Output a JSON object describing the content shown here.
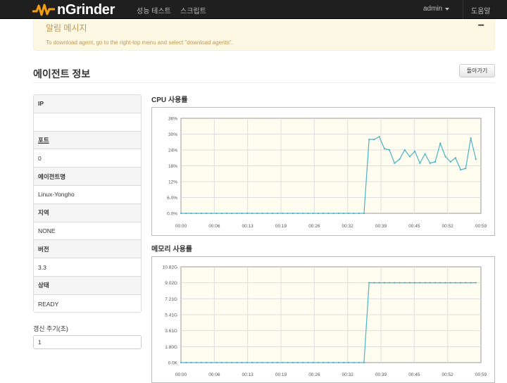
{
  "header": {
    "logo_text": "nGrinder",
    "nav": [
      "성능 테스트",
      "스크립트"
    ],
    "user": "admin",
    "help": "도움말"
  },
  "alert": {
    "title": "알림 메시지",
    "close": "−",
    "message": "To download agent, go to the right-top menu and select \"download agents\"."
  },
  "page": {
    "title": "에이전트 정보",
    "back_button": "돌아가기"
  },
  "agent_info": [
    {
      "label": "IP",
      "value": ""
    },
    {
      "label": "포트",
      "value": "0"
    },
    {
      "label": "에이전트명",
      "value": "Linux-Yongho"
    },
    {
      "label": "지역",
      "value": "NONE"
    },
    {
      "label": "버전",
      "value": "3.3"
    },
    {
      "label": "상태",
      "value": "READY"
    }
  ],
  "refresh": {
    "label": "갱신 주기(초)",
    "value": "1"
  },
  "colors": {
    "plot_bg": "#fffdf0",
    "grid": "#dddddd",
    "series": "#4bb2c5"
  },
  "chart_data": [
    {
      "type": "line",
      "title": "CPU 사용률",
      "x_ticks": [
        "00:00",
        "00:06",
        "00:13",
        "00:19",
        "00:26",
        "00:32",
        "00:39",
        "00:45",
        "00:52",
        "00:59"
      ],
      "y_ticks": [
        "0.0%",
        "6.0%",
        "12%",
        "18%",
        "24%",
        "30%",
        "36%"
      ],
      "ylim": [
        0,
        36
      ],
      "xlim": [
        0,
        59
      ],
      "values": [
        0,
        0,
        0,
        0,
        0,
        0,
        0,
        0,
        0,
        0,
        0,
        0,
        0,
        0,
        0,
        0,
        0,
        0,
        0,
        0,
        0,
        0,
        0,
        0,
        0,
        0,
        0,
        0,
        0,
        0,
        0,
        0,
        0,
        0,
        0,
        0,
        0,
        28,
        28,
        29,
        24.5,
        24,
        19,
        20.5,
        24,
        21.5,
        23.5,
        19,
        22.5,
        19,
        19.5,
        26.5,
        21.5,
        19.5,
        21,
        16.5,
        17,
        28.5,
        20.5
      ]
    },
    {
      "type": "line",
      "title": "메모리 사용률",
      "x_ticks": [
        "00:00",
        "00:06",
        "00:13",
        "00:19",
        "00:26",
        "00:32",
        "00:39",
        "00:45",
        "00:52",
        "00:59"
      ],
      "y_ticks": [
        "0.0K",
        "1.80G",
        "3.61G",
        "5.41G",
        "7.21G",
        "9.02G",
        "10.82G"
      ],
      "ylim": [
        0,
        10.82
      ],
      "xlim": [
        0,
        59
      ],
      "values": [
        0,
        0,
        0,
        0,
        0,
        0,
        0,
        0,
        0,
        0,
        0,
        0,
        0,
        0,
        0,
        0,
        0,
        0,
        0,
        0,
        0,
        0,
        0,
        0,
        0,
        0,
        0,
        0,
        0,
        0,
        0,
        0,
        0,
        0,
        0,
        0,
        0,
        9.02,
        9.02,
        9.02,
        9.02,
        9.02,
        9.02,
        9.02,
        9.02,
        9.02,
        9.02,
        9.02,
        9.02,
        9.02,
        9.02,
        9.02,
        9.02,
        9.02,
        9.02,
        9.02,
        9.02,
        9.02,
        9.02
      ]
    }
  ]
}
